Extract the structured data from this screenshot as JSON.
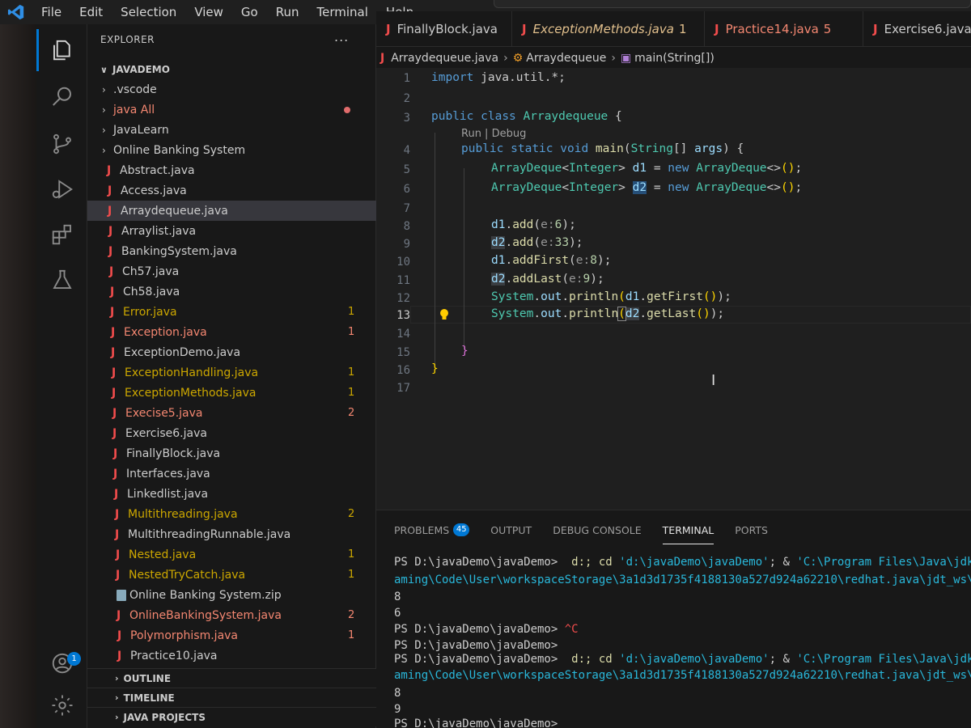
{
  "menu": [
    "File",
    "Edit",
    "Selection",
    "View",
    "Go",
    "Run",
    "Terminal",
    "Help"
  ],
  "explorer": {
    "title": "EXPLORER",
    "more": "...",
    "project": "JAVADEMO",
    "items": [
      {
        "label": ".vscode",
        "kind": "folder",
        "status": "plain",
        "badge": ""
      },
      {
        "label": "java All",
        "kind": "folder",
        "status": "err",
        "badge": ""
      },
      {
        "label": "JavaLearn",
        "kind": "folder",
        "status": "plain",
        "badge": ""
      },
      {
        "label": "Online Banking System",
        "kind": "folder",
        "status": "plain",
        "badge": ""
      },
      {
        "label": "Abstract.java",
        "kind": "java",
        "status": "plain",
        "badge": ""
      },
      {
        "label": "Access.java",
        "kind": "java",
        "status": "plain",
        "badge": ""
      },
      {
        "label": "Arraydequeue.java",
        "kind": "java",
        "status": "plain",
        "badge": ""
      },
      {
        "label": "Arraylist.java",
        "kind": "java",
        "status": "plain",
        "badge": ""
      },
      {
        "label": "BankingSystem.java",
        "kind": "java",
        "status": "plain",
        "badge": ""
      },
      {
        "label": "Ch57.java",
        "kind": "java",
        "status": "plain",
        "badge": ""
      },
      {
        "label": "Ch58.java",
        "kind": "java",
        "status": "plain",
        "badge": ""
      },
      {
        "label": "Error.java",
        "kind": "java",
        "status": "warn",
        "badge": "1"
      },
      {
        "label": "Exception.java",
        "kind": "java",
        "status": "err",
        "badge": "1"
      },
      {
        "label": "ExceptionDemo.java",
        "kind": "java",
        "status": "plain",
        "badge": ""
      },
      {
        "label": "ExceptionHandling.java",
        "kind": "java",
        "status": "warn",
        "badge": "1"
      },
      {
        "label": "ExceptionMethods.java",
        "kind": "java",
        "status": "warn",
        "badge": "1"
      },
      {
        "label": "Execise5.java",
        "kind": "java",
        "status": "err",
        "badge": "2"
      },
      {
        "label": "Exercise6.java",
        "kind": "java",
        "status": "plain",
        "badge": ""
      },
      {
        "label": "FinallyBlock.java",
        "kind": "java",
        "status": "plain",
        "badge": ""
      },
      {
        "label": "Interfaces.java",
        "kind": "java",
        "status": "plain",
        "badge": ""
      },
      {
        "label": "Linkedlist.java",
        "kind": "java",
        "status": "plain",
        "badge": ""
      },
      {
        "label": "Multithreading.java",
        "kind": "java",
        "status": "warn",
        "badge": "2"
      },
      {
        "label": "MultithreadingRunnable.java",
        "kind": "java",
        "status": "plain",
        "badge": ""
      },
      {
        "label": "Nested.java",
        "kind": "java",
        "status": "warn",
        "badge": "1"
      },
      {
        "label": "NestedTryCatch.java",
        "kind": "java",
        "status": "warn",
        "badge": "1"
      },
      {
        "label": "Online Banking System.zip",
        "kind": "zip",
        "status": "plain",
        "badge": ""
      },
      {
        "label": "OnlineBankingSystem.java",
        "kind": "java",
        "status": "err",
        "badge": "2"
      },
      {
        "label": "Polymorphism.java",
        "kind": "java",
        "status": "err",
        "badge": "1"
      },
      {
        "label": "Practice10.java",
        "kind": "java",
        "status": "plain",
        "badge": ""
      }
    ],
    "sections": [
      "OUTLINE",
      "TIMELINE",
      "JAVA PROJECTS"
    ]
  },
  "activity": {
    "accounts_badge": "1"
  },
  "tabs": [
    {
      "label": "FinallyBlock.java",
      "badge": "",
      "status": "plain"
    },
    {
      "label": "ExceptionMethods.java",
      "badge": "1",
      "status": "mod"
    },
    {
      "label": "Practice14.java",
      "badge": "5",
      "status": "err"
    },
    {
      "label": "Exercise6.java",
      "badge": "",
      "status": "plain"
    }
  ],
  "breadcrumb": {
    "file": "Arraydequeue.java",
    "class": "Arraydequeue",
    "method": "main(String[])"
  },
  "editor": {
    "line_numbers": [
      "1",
      "2",
      "3",
      "4",
      "5",
      "6",
      "7",
      "8",
      "9",
      "10",
      "11",
      "12",
      "13",
      "14",
      "15",
      "16",
      "17"
    ],
    "codelens": "Run | Debug",
    "lines": {
      "l1": [
        "import",
        " java.util.*;"
      ],
      "l3": [
        "public",
        " ",
        "class",
        " ",
        "Arraydequeue",
        " {"
      ],
      "l4": [
        "public",
        " ",
        "static",
        " ",
        "void",
        " ",
        "main",
        "(",
        "String",
        "[]",
        " ",
        "args",
        ") {"
      ],
      "l5": [
        "ArrayDeque",
        "<",
        "Integer",
        "> ",
        "d1",
        " = ",
        "new",
        " ",
        "ArrayDeque",
        "<>",
        "()",
        ";"
      ],
      "l6": [
        "ArrayDeque",
        "<",
        "Integer",
        "> ",
        "d2",
        " = ",
        "new",
        " ",
        "ArrayDeque",
        "<>",
        "()",
        ";"
      ],
      "l8": [
        "d1",
        ".",
        "add",
        "(",
        "e:",
        "6",
        ");"
      ],
      "l9": [
        "d2",
        ".",
        "add",
        "(",
        "e:",
        "33",
        ");"
      ],
      "l10": [
        "d1",
        ".",
        "addFirst",
        "(",
        "e:",
        "8",
        ");"
      ],
      "l11": [
        "d2",
        ".",
        "addLast",
        "(",
        "e:",
        "9",
        ");"
      ],
      "l12": [
        "System",
        ".",
        "out",
        ".",
        "println",
        "(",
        "d1",
        ".",
        "getFirst",
        "()",
        ");"
      ],
      "l13": [
        "System",
        ".",
        "out",
        ".",
        "println",
        "(",
        "d2",
        ".",
        "getLast",
        "()",
        ");"
      ],
      "l15": [
        "}"
      ],
      "l16": [
        "}"
      ]
    }
  },
  "panel": {
    "tabs": [
      "PROBLEMS",
      "OUTPUT",
      "DEBUG CONSOLE",
      "TERMINAL",
      "PORTS"
    ],
    "problems_count": "45",
    "terminal": [
      {
        "prompt": "PS D:\\javaDemo\\javaDemo> ",
        "cmd": " d:; cd ",
        "arg": "'d:\\javaDemo\\javaDemo'",
        "rest": "; & ",
        "arg2": "'C:\\Program Files\\Java\\jdk"
      },
      {
        "text": "aming\\Code\\User\\workspaceStorage\\3a1d3d1735f4188130a527d924a62210\\redhat.java\\jdt_ws\\"
      },
      {
        "text": "8"
      },
      {
        "text": "6"
      },
      {
        "prompt": "PS D:\\javaDemo\\javaDemo> ",
        "ctrl": "^C"
      },
      {
        "prompt": "PS D:\\javaDemo\\javaDemo> "
      },
      {
        "prompt": "PS D:\\javaDemo\\javaDemo> ",
        "cmd": " d:; cd ",
        "arg": "'d:\\javaDemo\\javaDemo'",
        "rest": "; & ",
        "arg2": "'C:\\Program Files\\Java\\jdk1"
      },
      {
        "text": "aming\\Code\\User\\workspaceStorage\\3a1d3d1735f4188130a527d924a62210\\redhat.java\\jdt_ws\\j"
      },
      {
        "text": "8"
      },
      {
        "text": "9"
      },
      {
        "prompt": "PS D:\\javaDemo\\javaDemo> "
      }
    ]
  },
  "colors": {
    "accent": "#0078d4",
    "editor_bg": "#1f1f1f",
    "sidebar_bg": "#181818"
  }
}
